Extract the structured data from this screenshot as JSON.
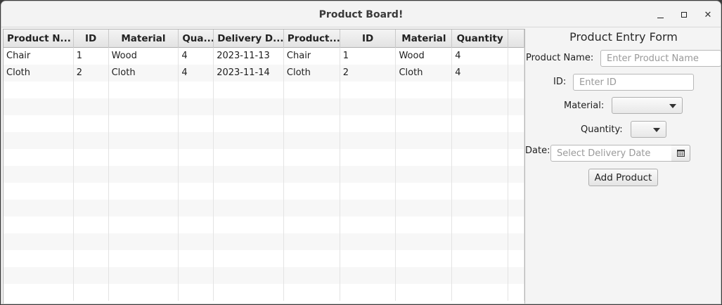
{
  "window": {
    "title": "Product Board!",
    "controls": {
      "minimize": "minimize-icon",
      "maximize": "maximize-icon",
      "close": "close-icon"
    }
  },
  "table": {
    "columns": [
      "Product N...",
      "ID",
      "Material",
      "Qua...",
      "Delivery D...",
      "Product...",
      "ID",
      "Material",
      "Quantity"
    ],
    "rows": [
      [
        "Chair",
        "1",
        "Wood",
        "4",
        "2023-11-13",
        "Chair",
        "1",
        "Wood",
        "4"
      ],
      [
        "Cloth",
        "2",
        "Cloth",
        "4",
        "2023-11-14",
        "Cloth",
        "2",
        "Cloth",
        "4"
      ]
    ]
  },
  "form": {
    "title": "Product Entry Form",
    "product_name_label": "Product Name:",
    "product_name_placeholder": "Enter Product Name",
    "product_name_value": "",
    "id_label": "ID:",
    "id_placeholder": "Enter ID",
    "id_value": "",
    "material_label": "Material:",
    "material_value": "",
    "quantity_label": "Quantity:",
    "quantity_value": "",
    "date_label": "Date:",
    "date_placeholder": "Select Delivery Date",
    "date_value": "",
    "date_icon": "calendar-icon",
    "submit_label": "Add Product"
  }
}
